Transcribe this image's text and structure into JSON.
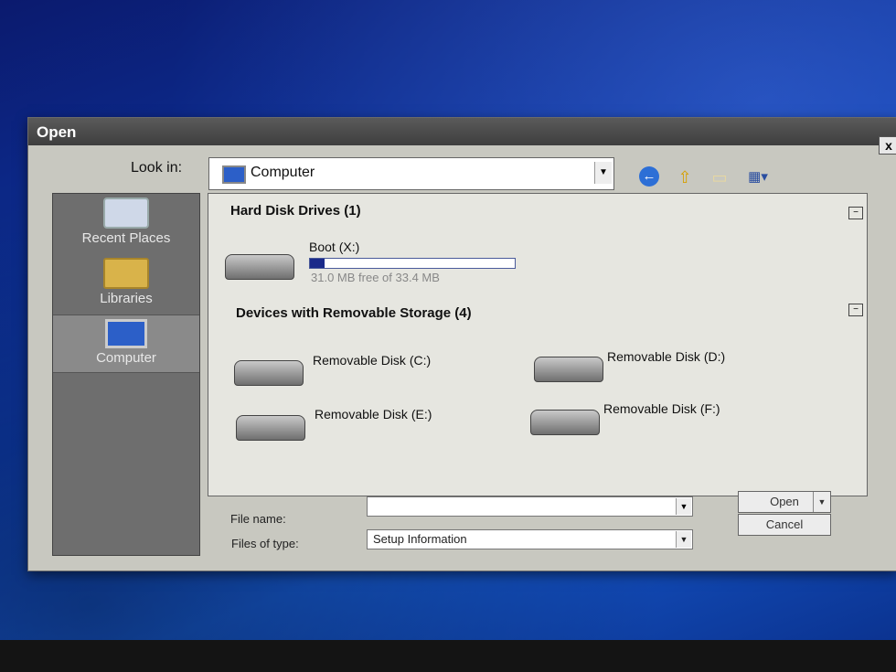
{
  "dialog": {
    "title": "Open",
    "close": "x"
  },
  "lookin": {
    "label": "Look in:",
    "value": "Computer"
  },
  "toolbar": {
    "back_icon": "back-arrow-icon",
    "up_icon": "up-folder-icon",
    "new_folder_icon": "new-folder-icon",
    "views_icon": "views-menu-icon"
  },
  "places": [
    {
      "label": "Recent Places"
    },
    {
      "label": "Libraries"
    },
    {
      "label": "Computer"
    }
  ],
  "groups": {
    "hard_disk": "Hard Disk Drives (1)",
    "removable": "Devices with Removable Storage (4)"
  },
  "boot_drive": {
    "name": "Boot (X:)",
    "space": "31.0 MB free of 33.4 MB",
    "used_fraction": 0.072
  },
  "removable_drives": [
    {
      "name": "Removable Disk (C:)"
    },
    {
      "name": "Removable Disk (D:)"
    },
    {
      "name": "Removable Disk (E:)"
    },
    {
      "name": "Removable Disk (F:)"
    }
  ],
  "footer": {
    "file_name_label": "File name:",
    "file_name_value": "",
    "file_type_label": "Files of type:",
    "file_type_value": "Setup Information",
    "open_label": "Open",
    "cancel_label": "Cancel"
  }
}
